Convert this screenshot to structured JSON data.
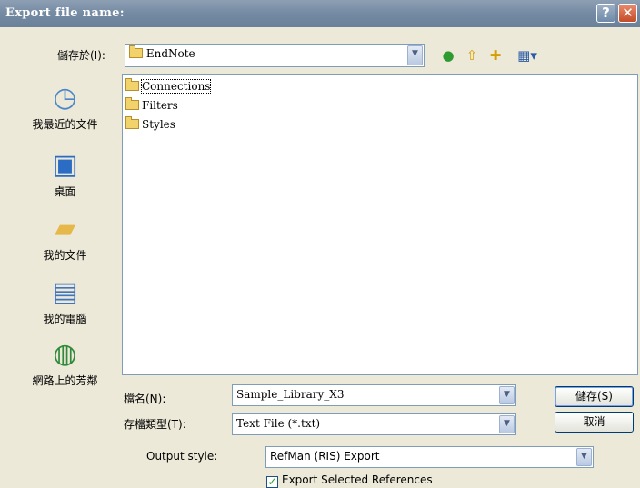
{
  "dialog": {
    "title": "Export file name:",
    "help_glyph": "?",
    "close_glyph": "✕"
  },
  "toolbar": {
    "save_in_label": "儲存於(I):",
    "save_in_value": "EndNote",
    "back_icon": "back-icon",
    "up_icon": "up-folder-icon",
    "new_folder_icon": "new-folder-icon",
    "views_icon": "views-menu-icon"
  },
  "places": [
    {
      "label": "我最近的文件",
      "icon": "recent-documents-icon"
    },
    {
      "label": "桌面",
      "icon": "desktop-icon"
    },
    {
      "label": "我的文件",
      "icon": "my-documents-icon"
    },
    {
      "label": "我的電腦",
      "icon": "my-computer-icon"
    },
    {
      "label": "網路上的芳鄰",
      "icon": "network-places-icon"
    }
  ],
  "files": [
    {
      "name": "Connections"
    },
    {
      "name": "Filters"
    },
    {
      "name": "Styles"
    }
  ],
  "file_name": {
    "label": "檔名(N):",
    "value": "Sample_Library_X3"
  },
  "file_type": {
    "label": "存檔類型(T):",
    "value": "Text File (*.txt)"
  },
  "buttons": {
    "save": "儲存(S)",
    "cancel": "取消"
  },
  "output_style": {
    "label": "Output style:",
    "value": "RefMan (RIS) Export"
  },
  "export_selected": {
    "label": "Export Selected References",
    "checked": true
  }
}
